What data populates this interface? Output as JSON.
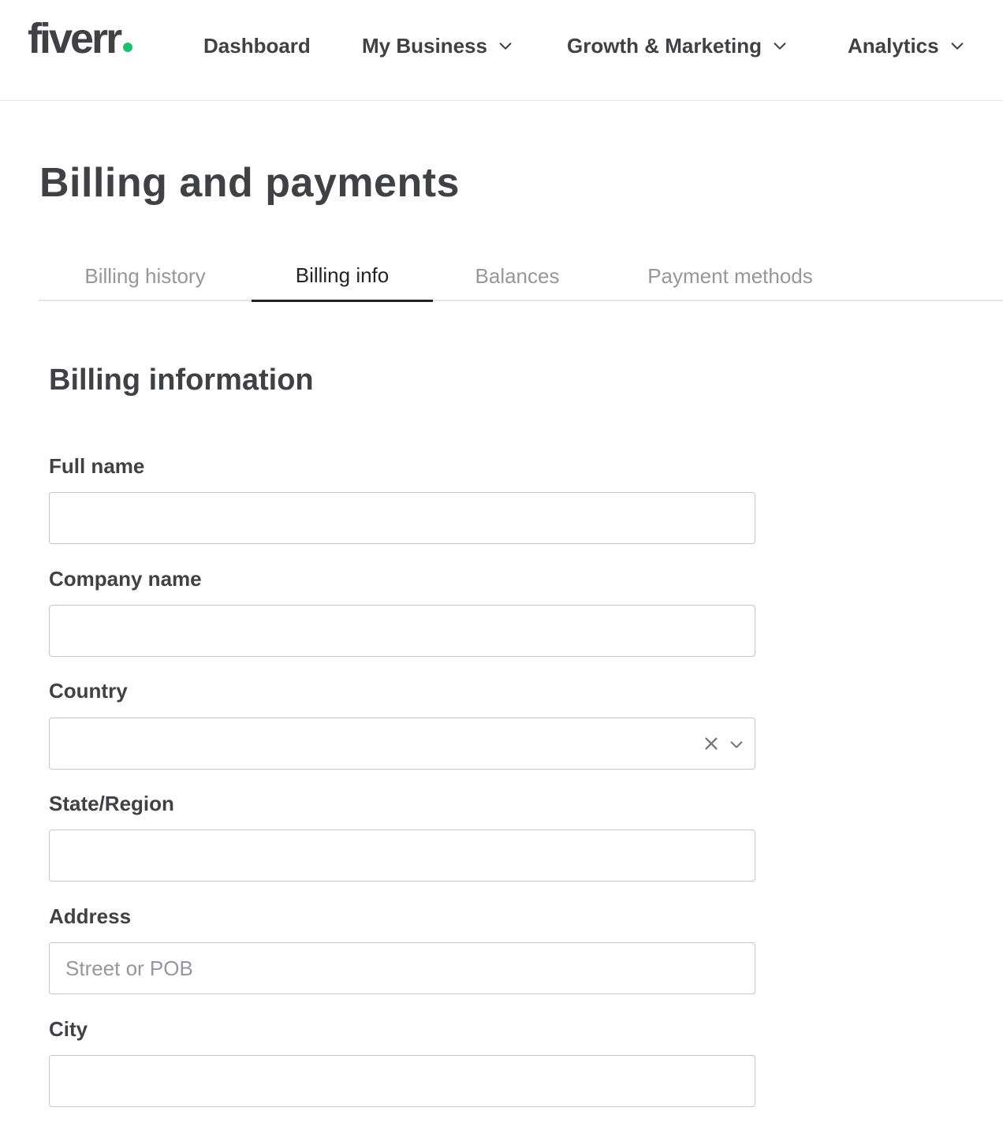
{
  "brand": {
    "logo_text": "fiverr",
    "accent_color": "#1dbf73"
  },
  "nav": {
    "items": [
      {
        "label": "Dashboard",
        "has_dropdown": false
      },
      {
        "label": "My Business",
        "has_dropdown": true,
        "icon": "chevron-down-icon"
      },
      {
        "label": "Growth & Marketing",
        "has_dropdown": true,
        "icon": "chevron-down-icon"
      },
      {
        "label": "Analytics",
        "has_dropdown": true,
        "icon": "chevron-down-icon"
      }
    ]
  },
  "page": {
    "title": "Billing and payments"
  },
  "tabs": [
    {
      "label": "Billing history",
      "active": false
    },
    {
      "label": "Billing info",
      "active": true
    },
    {
      "label": "Balances",
      "active": false
    },
    {
      "label": "Payment methods",
      "active": false
    }
  ],
  "form": {
    "section_title": "Billing information",
    "fields": {
      "full_name": {
        "label": "Full name",
        "value": "",
        "placeholder": ""
      },
      "company_name": {
        "label": "Company name",
        "value": "",
        "placeholder": ""
      },
      "country": {
        "label": "Country",
        "value": "",
        "icons": [
          "clear-icon",
          "chevron-down-icon"
        ]
      },
      "state_region": {
        "label": "State/Region",
        "value": "",
        "placeholder": ""
      },
      "address": {
        "label": "Address",
        "value": "",
        "placeholder": "Street or POB"
      },
      "city": {
        "label": "City",
        "value": "",
        "placeholder": ""
      }
    }
  },
  "colors": {
    "text_primary": "#404145",
    "text_muted": "#95979d",
    "tab_active": "#222325",
    "border": "#c5c6c9",
    "divider": "#e4e5e7"
  }
}
